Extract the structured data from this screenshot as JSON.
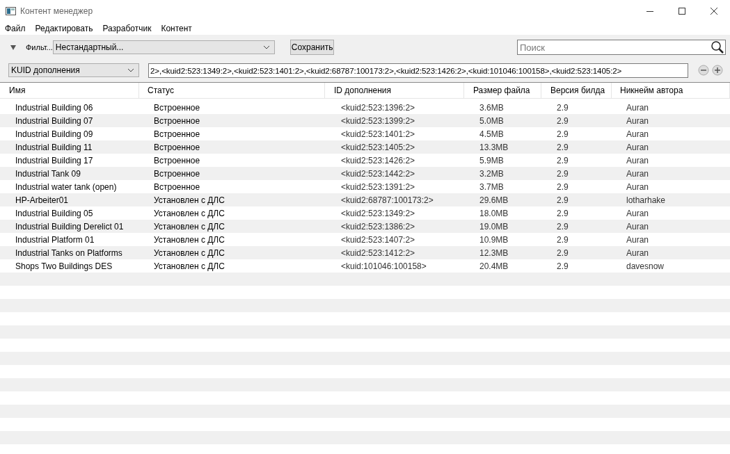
{
  "window": {
    "title": "Контент менеджер"
  },
  "menu": [
    "Файл",
    "Редактировать",
    "Разработчик",
    "Контент"
  ],
  "filter_bar": {
    "expanded": true,
    "label": "Фильт...",
    "preset": "Нестандартный...",
    "save_button": "Сохранить",
    "search": {
      "placeholder": "Поиск"
    }
  },
  "condition": {
    "field": "KUID дополнения",
    "value": "2>,<kuid2:523:1349:2>,<kuid2:523:1401:2>,<kuid2:68787:100173:2>,<kuid2:523:1426:2>,<kuid:101046:100158>,<kuid2:523:1405:2>"
  },
  "table": {
    "columns": [
      "Имя",
      "Статус",
      "ID дополнения",
      "Размер файла",
      "Версия билда",
      "Никнейм автора"
    ],
    "rows": [
      [
        "Industrial Building 06",
        "Встроенное",
        "<kuid2:523:1396:2>",
        "3.6MB",
        "2.9",
        "Auran"
      ],
      [
        "Industrial Building 07",
        "Встроенное",
        "<kuid2:523:1399:2>",
        "5.0MB",
        "2.9",
        "Auran"
      ],
      [
        "Industrial Building 09",
        "Встроенное",
        "<kuid2:523:1401:2>",
        "4.5MB",
        "2.9",
        "Auran"
      ],
      [
        "Industrial Building 11",
        "Встроенное",
        "<kuid2:523:1405:2>",
        "13.3MB",
        "2.9",
        "Auran"
      ],
      [
        "Industrial Building 17",
        "Встроенное",
        "<kuid2:523:1426:2>",
        "5.9MB",
        "2.9",
        "Auran"
      ],
      [
        "Industrial Tank 09",
        "Встроенное",
        "<kuid2:523:1442:2>",
        "3.2MB",
        "2.9",
        "Auran"
      ],
      [
        "Industrial water tank (open)",
        "Встроенное",
        "<kuid2:523:1391:2>",
        "3.7MB",
        "2.9",
        "Auran"
      ],
      [
        "HP-Arbeiter01",
        "Установлен с ДЛС",
        "<kuid2:68787:100173:2>",
        "29.6MB",
        "2.9",
        "lotharhake"
      ],
      [
        "Industrial Building 05",
        "Установлен с ДЛС",
        "<kuid2:523:1349:2>",
        "18.0MB",
        "2.9",
        "Auran"
      ],
      [
        "Industrial Building Derelict 01",
        "Установлен с ДЛС",
        "<kuid2:523:1386:2>",
        "19.0MB",
        "2.9",
        "Auran"
      ],
      [
        "Industrial Platform 01",
        "Установлен с ДЛС",
        "<kuid2:523:1407:2>",
        "10.9MB",
        "2.9",
        "Auran"
      ],
      [
        "Industrial Tanks on Platforms",
        "Установлен с ДЛС",
        "<kuid2:523:1412:2>",
        "12.3MB",
        "2.9",
        "Auran"
      ],
      [
        "Shops Two Buildings DES",
        "Установлен с ДЛС",
        "<kuid:101046:100158>",
        "20.4MB",
        "2.9",
        "davesnow"
      ]
    ]
  }
}
